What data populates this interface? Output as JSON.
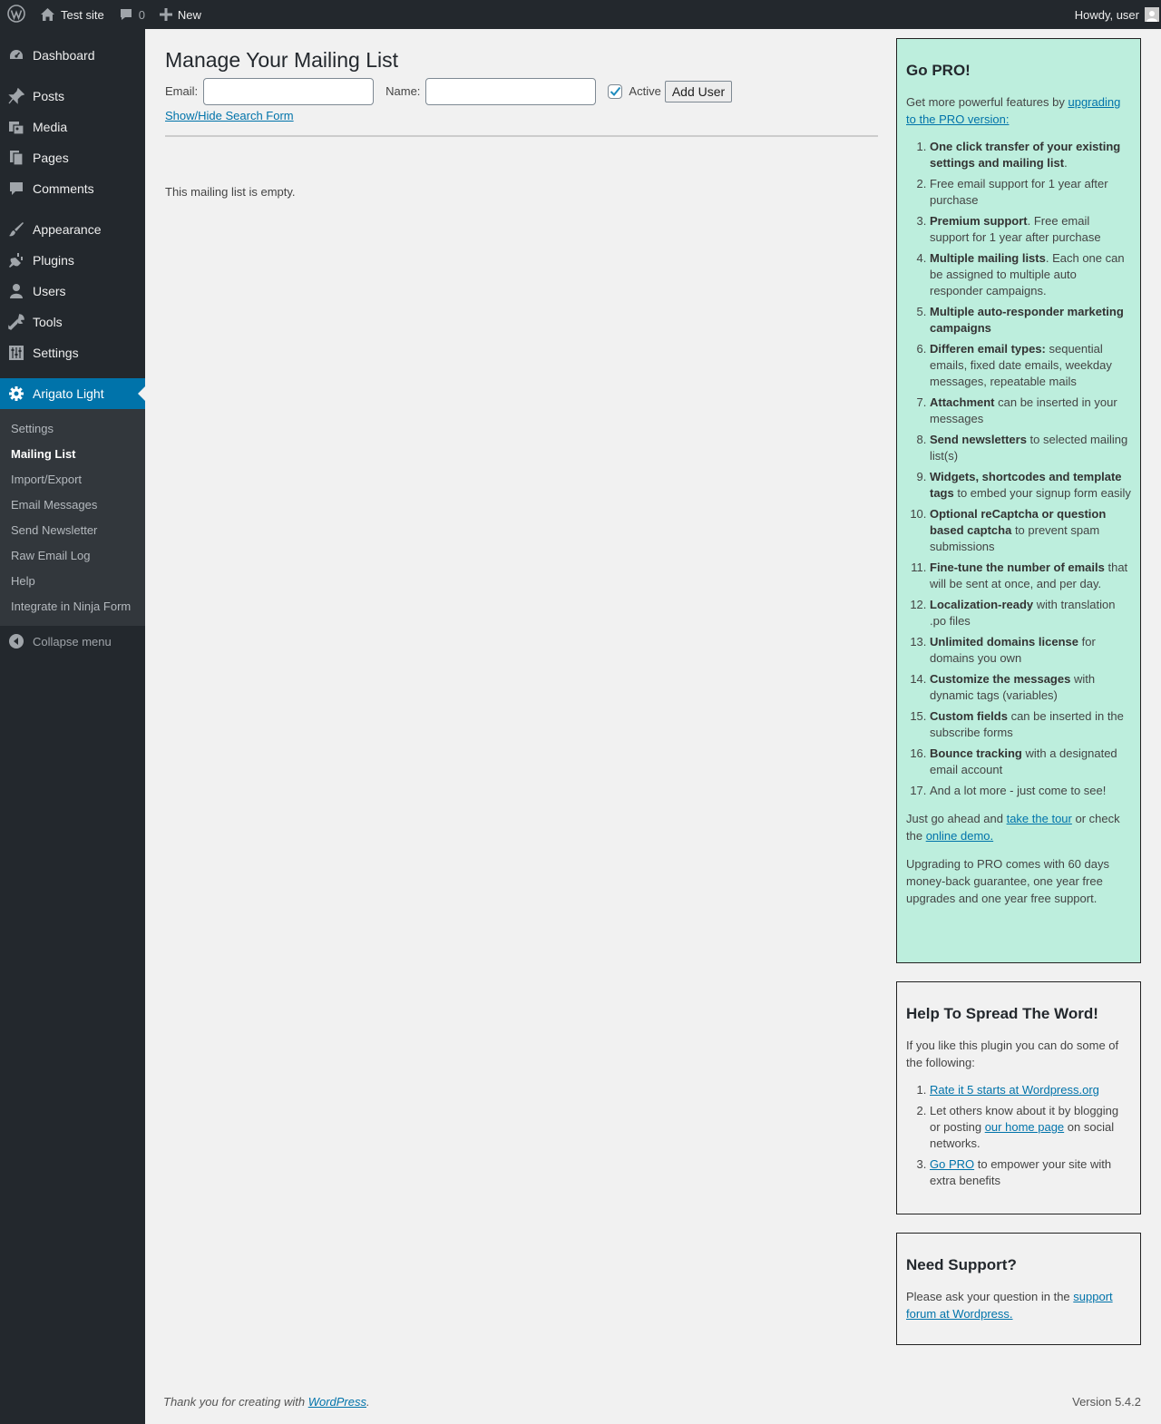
{
  "adminbar": {
    "site_name": "Test site",
    "comments_count": "0",
    "new_label": "New",
    "howdy": "Howdy, user"
  },
  "sidebar": {
    "items": [
      {
        "label": "Dashboard",
        "icon": "dashboard-icon"
      },
      {
        "label": "Posts",
        "icon": "pin-icon"
      },
      {
        "label": "Media",
        "icon": "media-icon"
      },
      {
        "label": "Pages",
        "icon": "pages-icon"
      },
      {
        "label": "Comments",
        "icon": "comment-icon"
      },
      {
        "label": "Appearance",
        "icon": "brush-icon"
      },
      {
        "label": "Plugins",
        "icon": "plugin-icon"
      },
      {
        "label": "Users",
        "icon": "user-icon"
      },
      {
        "label": "Tools",
        "icon": "wrench-icon"
      },
      {
        "label": "Settings",
        "icon": "settings-icon"
      },
      {
        "label": "Arigato Light",
        "icon": "gear-icon"
      }
    ],
    "submenu": [
      "Settings",
      "Mailing List",
      "Import/Export",
      "Email Messages",
      "Send Newsletter",
      "Raw Email Log",
      "Help",
      "Integrate in Ninja Form"
    ],
    "collapse_label": "Collapse menu"
  },
  "main": {
    "title": "Manage Your Mailing List",
    "email_label": "Email:",
    "name_label": "Name:",
    "email_value": "",
    "name_value": "",
    "active_label": "Active",
    "active_checked": true,
    "add_button": "Add User",
    "show_hide_link": "Show/Hide Search Form",
    "empty_message": "This mailing list is empty."
  },
  "gopro": {
    "title": "Go PRO!",
    "intro": "Get more powerful features by ",
    "intro_link": "upgrading to the PRO version:",
    "features": [
      {
        "bold": "One click transfer of your existing settings and mailing list",
        "rest": "."
      },
      {
        "bold": "",
        "rest": "Free email support for 1 year after purchase"
      },
      {
        "bold": "Premium support",
        "rest": ". Free email support for 1 year after purchase"
      },
      {
        "bold": "Multiple mailing lists",
        "rest": ". Each one can be assigned to multiple auto responder campaigns."
      },
      {
        "bold": "Multiple auto-responder marketing campaigns",
        "rest": ""
      },
      {
        "bold": "Differen email types:",
        "rest": " sequential emails, fixed date emails, weekday messages, repeatable mails"
      },
      {
        "bold": "Attachment",
        "rest": " can be inserted in your messages"
      },
      {
        "bold": "Send newsletters",
        "rest": " to selected mailing list(s)"
      },
      {
        "bold": "Widgets, shortcodes and template tags",
        "rest": " to embed your signup form easily"
      },
      {
        "bold": "Optional reCaptcha or question based captcha",
        "rest": " to prevent spam submissions"
      },
      {
        "bold": "Fine-tune the number of emails",
        "rest": " that will be sent at once, and per day."
      },
      {
        "bold": "Localization-ready",
        "rest": " with translation .po files"
      },
      {
        "bold": "Unlimited domains license",
        "rest": " for domains you own"
      },
      {
        "bold": "Customize the messages",
        "rest": " with dynamic tags (variables)"
      },
      {
        "bold": "Custom fields",
        "rest": " can be inserted in the subscribe forms"
      },
      {
        "bold": "Bounce tracking",
        "rest": " with a designated email account"
      },
      {
        "bold": "",
        "rest": "And a lot more - just come to see!"
      }
    ],
    "tour_pre": "Just go ahead and ",
    "tour_link": "take the tour",
    "tour_mid": " or check the ",
    "demo_link": "online demo.",
    "guarantee": "Upgrading to PRO comes with 60 days money-back guarantee, one year free upgrades and one year free support."
  },
  "spread": {
    "title": "Help To Spread The Word!",
    "intro": "If you like this plugin you can do some of the following:",
    "item1_link": "Rate it 5 starts at Wordpress.org",
    "item2_pre": "Let others know about it by blogging or posting ",
    "item2_link": "our home page",
    "item2_post": " on social networks.",
    "item3_link": "Go PRO",
    "item3_post": " to empower your site with extra benefits"
  },
  "support": {
    "title": "Need Support?",
    "text": "Please ask your question in the ",
    "link": "support forum at Wordpress."
  },
  "footer": {
    "thanks_pre": "Thank you for creating with ",
    "thanks_link": "WordPress",
    "thanks_post": ".",
    "version": "Version 5.4.2"
  },
  "colors": {
    "adminbar_bg": "#23282d",
    "menu_current": "#0073aa",
    "submenu_bg": "#32373c",
    "gopro_bg": "#bdeedd",
    "link": "#0073aa"
  }
}
